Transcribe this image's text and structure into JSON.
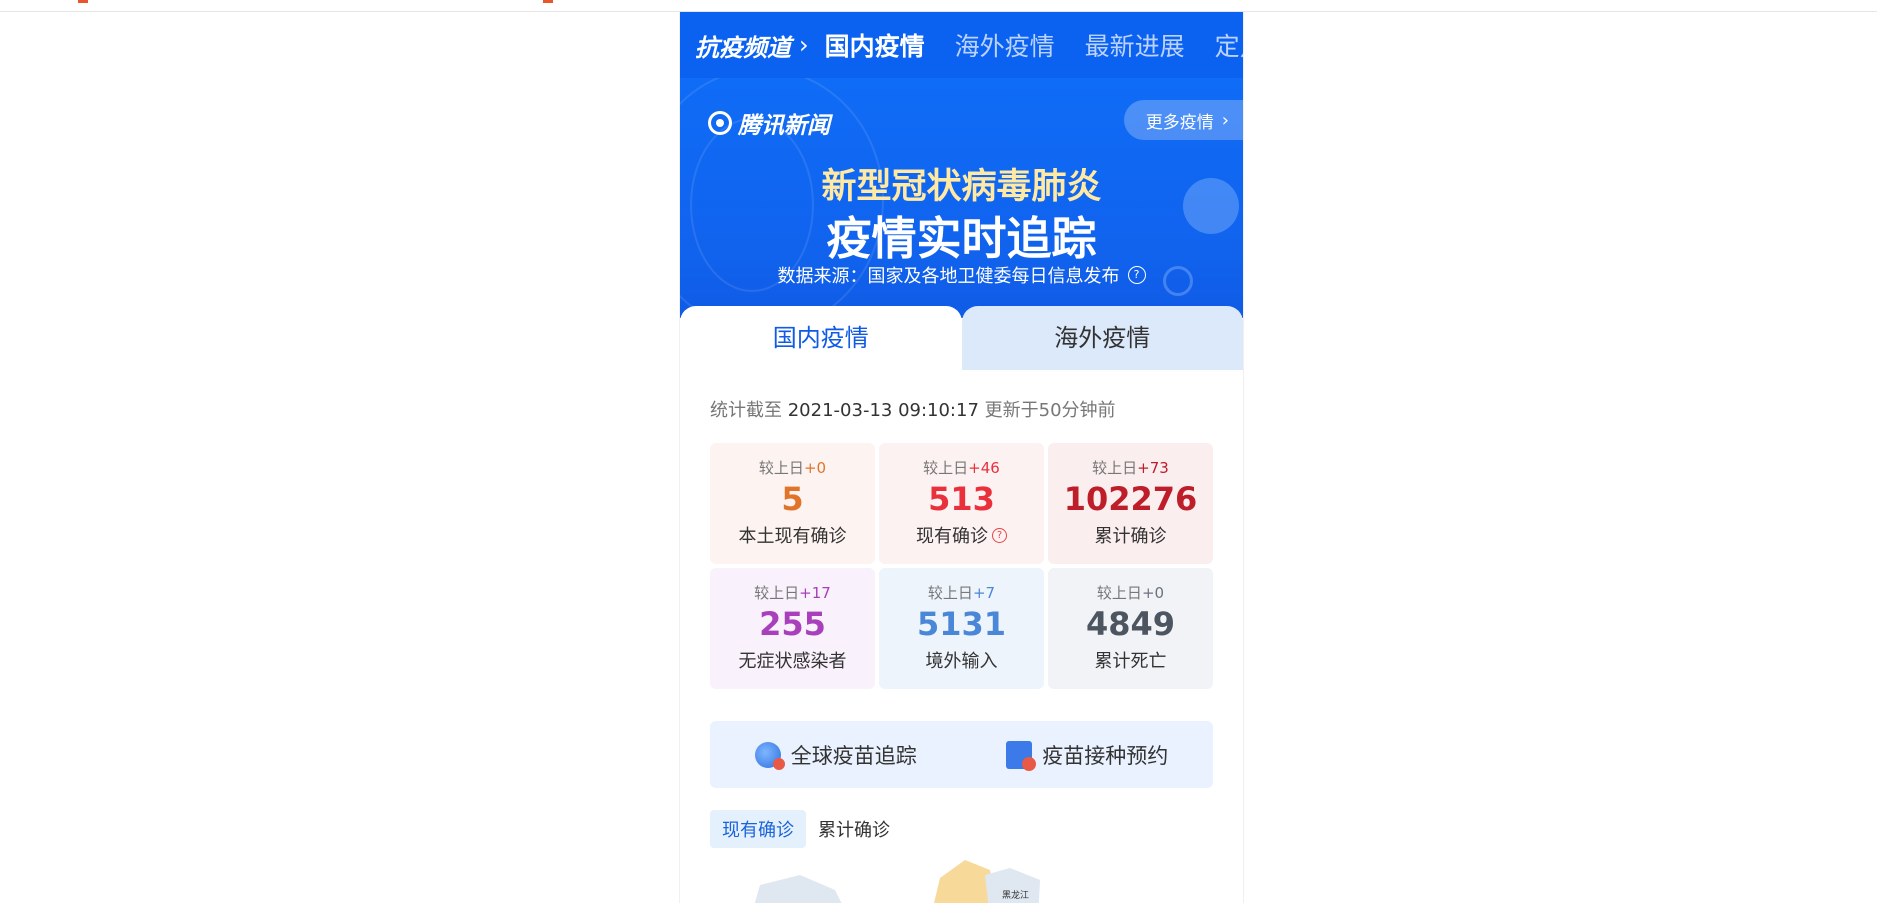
{
  "nav": {
    "channel": "抗疫频道",
    "tabs": [
      "国内疫情",
      "海外疫情",
      "最新进展",
      "定点"
    ]
  },
  "banner": {
    "logo": "腾讯新闻",
    "more_button": "更多疫情",
    "title_line1": "新型冠状病毒肺炎",
    "title_line2": "疫情实时追踪",
    "source": "数据来源：国家及各地卫健委每日信息发布",
    "help_glyph": "?"
  },
  "tabs": {
    "domestic": "国内疫情",
    "overseas": "海外疫情"
  },
  "stats_time": {
    "prefix": "统计截至",
    "datetime": "2021-03-13 09:10:17",
    "updated": "更新于50分钟前"
  },
  "stats": [
    {
      "delta_label": "较上日",
      "delta": "+0",
      "value": "5",
      "label": "本土现有确诊",
      "color": "#e0742b",
      "bg": "#fdf4f1",
      "delta_color": "#e0742b"
    },
    {
      "delta_label": "较上日",
      "delta": "+46",
      "value": "513",
      "label": "现有确诊",
      "color": "#e8313b",
      "bg": "#fdf2f2",
      "delta_color": "#e8313b",
      "help": true
    },
    {
      "delta_label": "较上日",
      "delta": "+73",
      "value": "102276",
      "label": "累计确诊",
      "color": "#be1d2a",
      "bg": "#fbeeee",
      "delta_color": "#be1d2a"
    },
    {
      "delta_label": "较上日",
      "delta": "+17",
      "value": "255",
      "label": "无症状感染者",
      "color": "#a83fbb",
      "bg": "#f9f1fb",
      "delta_color": "#a83fbb"
    },
    {
      "delta_label": "较上日",
      "delta": "+7",
      "value": "5131",
      "label": "境外输入",
      "color": "#4a87d6",
      "bg": "#eef4fc",
      "delta_color": "#4a87d6"
    },
    {
      "delta_label": "较上日",
      "delta": "+0",
      "value": "4849",
      "label": "累计死亡",
      "color": "#4d5561",
      "bg": "#f1f3f6",
      "delta_color": "#6b7280"
    }
  ],
  "vaccine": {
    "tracking": "全球疫苗追踪",
    "appointment": "疫苗接种预约"
  },
  "map_tabs": {
    "current": "现有确诊",
    "cumulative": "累计确诊"
  },
  "map": {
    "region_label": "黑龙江"
  }
}
